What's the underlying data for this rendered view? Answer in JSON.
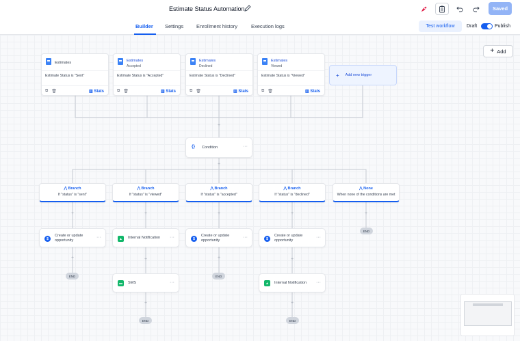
{
  "header": {
    "title": "Estimate Status Automation",
    "saved_label": "Saved"
  },
  "tabs": [
    {
      "label": "Builder",
      "active": true
    },
    {
      "label": "Settings"
    },
    {
      "label": "Enrollment history"
    },
    {
      "label": "Execution logs"
    }
  ],
  "toolbar": {
    "test_label": "Test workflow",
    "draft_label": "Draft",
    "publish_label": "Publish",
    "add_label": "Add"
  },
  "triggers": [
    {
      "name": "Estimates",
      "sub": "",
      "condition": "Estimate Status is \"Sent\"",
      "stats": "Stats"
    },
    {
      "name": "Estimates",
      "sub": "Accepted",
      "condition": "Estimate Status is \"Accepted\"",
      "stats": "Stats"
    },
    {
      "name": "Estimates",
      "sub": "Declined",
      "condition": "Estimate Status is \"Declined\"",
      "stats": "Stats"
    },
    {
      "name": "Estimates",
      "sub": "Viewed",
      "condition": "Estimate Status is \"Viewed\"",
      "stats": "Stats"
    }
  ],
  "add_trigger_label": "Add new trigger",
  "condition_label": "Condition",
  "branches": [
    {
      "name": "Branch",
      "condition": "If \"status\" is \"sent\""
    },
    {
      "name": "Branch",
      "condition": "If \"status\" is \"viewed\""
    },
    {
      "name": "Branch",
      "condition": "If \"status\" is \"accepted\""
    },
    {
      "name": "Branch",
      "condition": "If \"status\" is \"declined\""
    },
    {
      "name": "None",
      "condition": "When none of the conditions are met"
    }
  ],
  "actions": {
    "b1_1": "Create or update opportunity",
    "b2_1": "Internal Notification",
    "b2_2": "SMS",
    "b3_1": "Create or update opportunity",
    "b4_1": "Create or update opportunity",
    "b4_2": "Internal Notification"
  },
  "end_label": "END",
  "colors": {
    "accent": "#155eef",
    "saved_bg": "#93b4f6",
    "green": "#12b76a"
  }
}
